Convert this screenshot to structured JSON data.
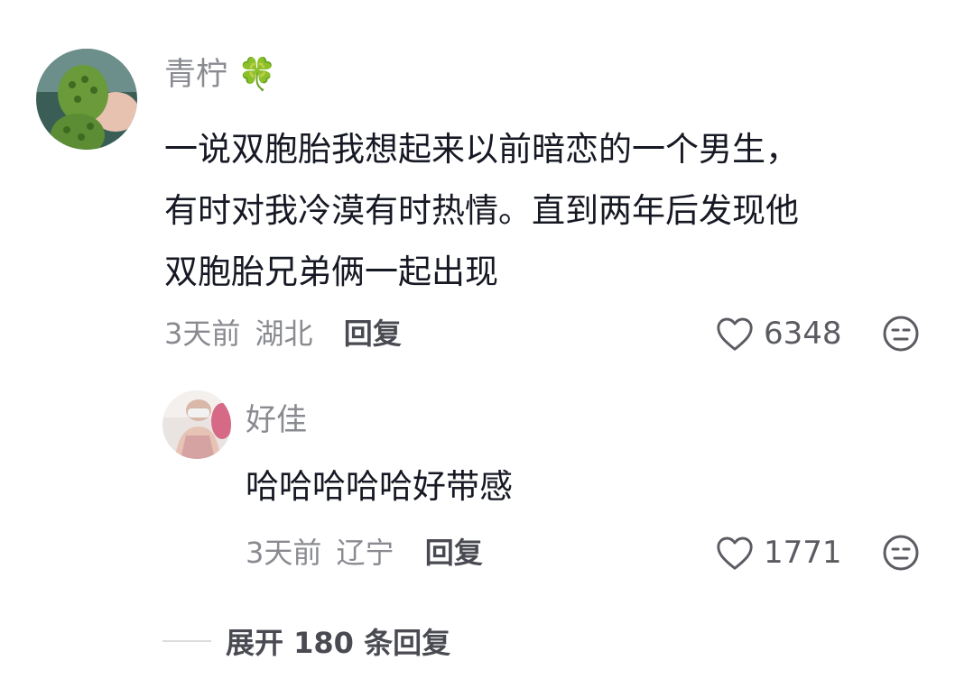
{
  "comments": [
    {
      "username": "青柠",
      "username_emoji": "🍀",
      "text_lines": [
        "一说双胞胎我想起来以前暗恋的一个男生，",
        "有时对我冷漠有时热情。直到两年后发现他",
        "双胞胎兄弟俩一起出现"
      ],
      "time": "3天前",
      "location": "湖北",
      "reply_label": "回复",
      "likes": "6348"
    },
    {
      "username": "好佳",
      "text": "哈哈哈哈哈好带感",
      "time": "3天前",
      "location": "辽宁",
      "reply_label": "回复",
      "likes": "1771"
    }
  ],
  "expand_label": "展开 180 条回复",
  "colors": {
    "secondary_text": "#8a8b91",
    "primary_text": "#161823",
    "accent_green": "#5a8a3c"
  }
}
